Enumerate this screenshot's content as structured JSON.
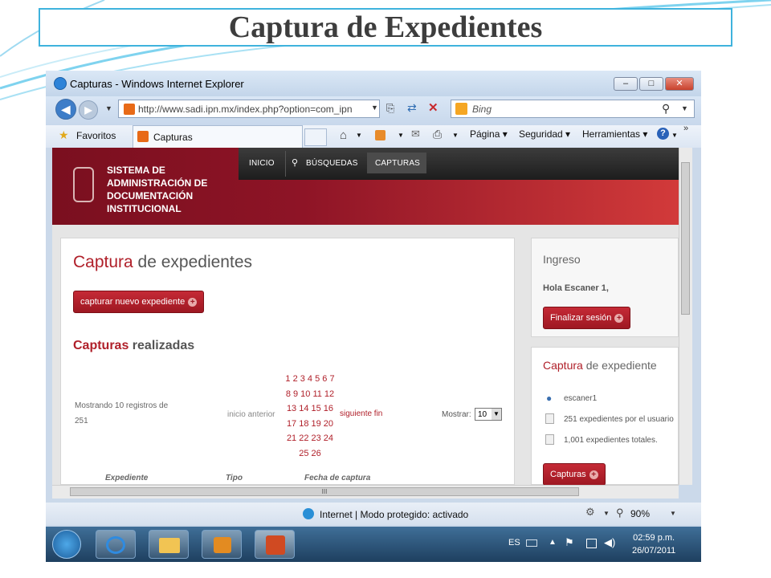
{
  "slide": {
    "title": "Captura de Expedientes"
  },
  "window": {
    "title": "Capturas - Windows Internet Explorer",
    "address": "http://www.sadi.ipn.mx/index.php?option=com_ipn",
    "search_placeholder": "Bing",
    "favorites_label": "Favoritos",
    "tab_label": "Capturas",
    "commands": {
      "page": "Página",
      "security": "Seguridad",
      "tools": "Herramientas"
    },
    "scroll_mark": "III"
  },
  "site": {
    "title_lines": [
      "SISTEMA DE",
      "ADMINISTRACIÓN DE",
      "DOCUMENTACIÓN",
      "INSTITUCIONAL"
    ],
    "menu": [
      "INICIO",
      "BÚSQUEDAS",
      "CAPTURAS"
    ]
  },
  "main": {
    "heading_accent": "Captura",
    "heading_rest": " de expedientes",
    "new_button": "capturar nuevo expediente",
    "sub_accent": "Capturas",
    "sub_rest": " realizadas",
    "showing_line1": "Mostrando 10 registros de",
    "showing_line2": "251",
    "prev_links": "inicio anterior",
    "next_links": "siguiente fin",
    "show_label": "Mostrar:",
    "show_value": "10",
    "page_rows": [
      "1 2 3 4 5 6 7",
      "8 9 10 11 12",
      "13 14 15 16",
      "17 18 19 20",
      "21 22 23 24",
      "25 26"
    ],
    "columns": [
      "Expediente",
      "Tipo",
      "Fecha de captura"
    ]
  },
  "login": {
    "title": "Ingreso",
    "greeting": "Hola Escaner 1,",
    "logout_button": "Finalizar sesión"
  },
  "stats": {
    "title_accent": "Captura",
    "title_rest": " de expediente",
    "user": "escaner1",
    "user_count": "251 expedientes por el usuario",
    "total_count": "1,001 expedientes totales.",
    "button": "Capturas"
  },
  "status": {
    "zone": "Internet | Modo protegido: activado",
    "zoom": "90%"
  },
  "taskbar": {
    "lang": "ES",
    "time": "02:59 p.m.",
    "date": "26/07/2011"
  }
}
